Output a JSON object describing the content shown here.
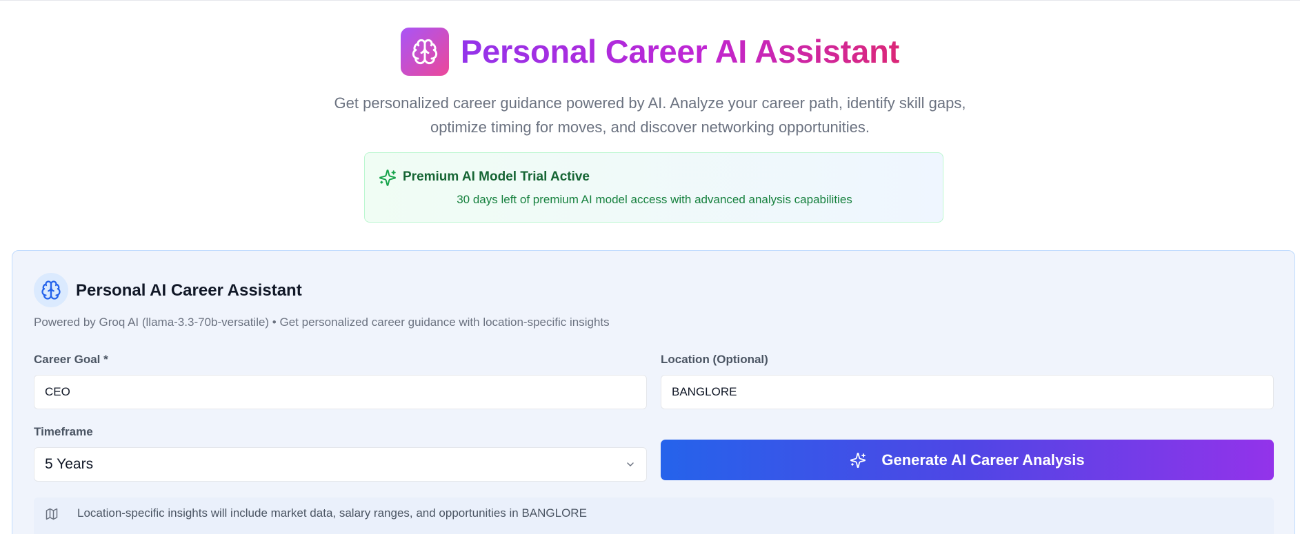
{
  "header": {
    "title": "Personal Career AI Assistant",
    "logo_icon": "brain-icon",
    "subtitle_line1": "Get personalized career guidance powered by AI. Analyze your career path, identify skill gaps,",
    "subtitle_line2": "optimize timing for moves, and discover networking opportunities."
  },
  "trial_banner": {
    "icon": "sparkles-icon",
    "title": "Premium AI Model Trial Active",
    "text": "30 days left of premium AI model access with advanced analysis capabilities"
  },
  "assistant_card": {
    "icon": "brain-icon",
    "title": "Personal AI Career Assistant",
    "description": "Powered by Groq AI (llama-3.3-70b-versatile) • Get personalized career guidance with location-specific insights",
    "career_goal": {
      "label": "Career Goal *",
      "value": "CEO"
    },
    "location": {
      "label": "Location (Optional)",
      "value": "BANGLORE"
    },
    "timeframe": {
      "label": "Timeframe",
      "value": "5 Years",
      "icon": "chevron-down-icon"
    },
    "generate_button": {
      "label": "Generate AI Career Analysis",
      "icon": "sparkles-icon"
    },
    "location_note": {
      "icon": "map-icon",
      "text": "Location-specific insights will include market data, salary ranges, and opportunities in BANGLORE"
    }
  },
  "colors": {
    "title_gradient_start": "#9333ea",
    "title_gradient_end": "#db2777",
    "trial_green": "#166534",
    "button_gradient_start": "#2563eb",
    "button_gradient_end": "#9333ea",
    "card_border": "#bfdbfe"
  }
}
